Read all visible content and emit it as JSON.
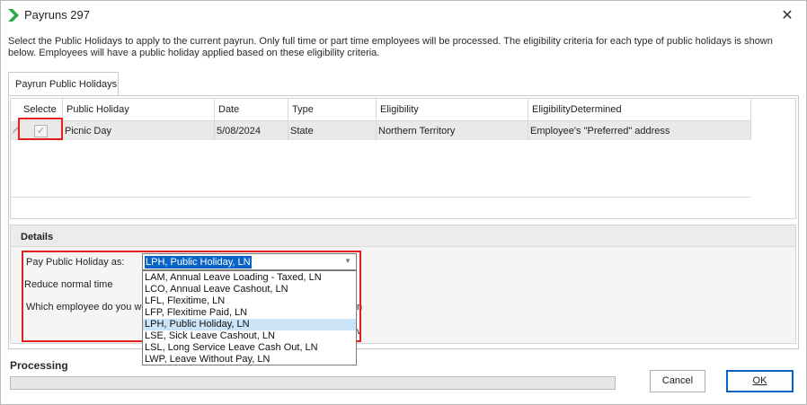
{
  "window": {
    "title": "Payruns 297",
    "close_icon": "close-icon"
  },
  "description": "Select the Public Holidays to apply to the current payrun. Only full time or part time employees will be processed. The eligibility criteria for each type of public holidays is shown below. Employees will have a public holiday applied based on these eligibility criteria.",
  "tabs": [
    {
      "label": "Payrun Public Holidays"
    }
  ],
  "grid": {
    "columns": [
      "Selecte",
      "Public Holiday",
      "Date",
      "Type",
      "Eligibility",
      "EligibilityDetermined"
    ],
    "rows": [
      {
        "selected": true,
        "public_holiday": "Picnic Day",
        "date": "5/08/2024",
        "type": "State",
        "eligibility": "Northern Territory",
        "eligibility_determined": "Employee's \"Preferred\" address"
      }
    ]
  },
  "details": {
    "header": "Details",
    "pay_label": "Pay Public Holiday as:",
    "reduce_label": "Reduce normal time",
    "which_label": "Which employee do you wis",
    "behind_n": "n",
    "behind_v": "v",
    "combo_value": "LPH, Public Holiday, LN",
    "options": [
      "LAM, Annual Leave Loading - Taxed, LN",
      "LCO, Annual Leave Cashout, LN",
      "LFL, Flexitime, LN",
      "LFP, Flexitime Paid, LN",
      "LPH, Public Holiday, LN",
      "LSE, Sick Leave Cashout, LN",
      "LSL, Long Service Leave Cash Out, LN",
      "LWP, Leave Without Pay, LN"
    ],
    "selected_option_index": 4
  },
  "processing": {
    "label": "Processing",
    "progress": 0
  },
  "buttons": {
    "cancel": "Cancel",
    "ok": "OK"
  },
  "colors": {
    "accent": "#0a64c8",
    "highlight": "#e21e1e",
    "selected_option": "#cce4f7"
  }
}
